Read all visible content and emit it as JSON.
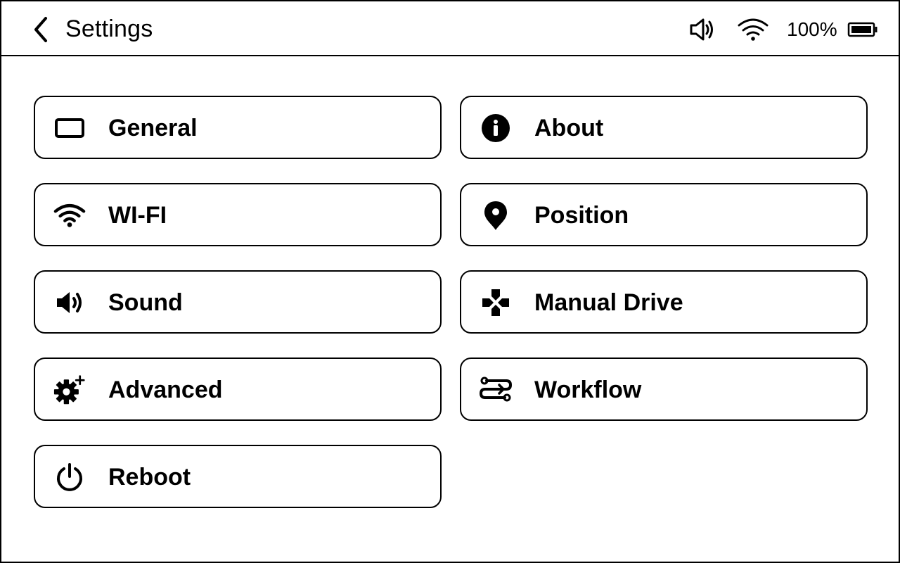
{
  "header": {
    "title": "Settings",
    "battery_text": "100%",
    "back_icon": "chevron-left-icon",
    "status_icons": [
      "volume-icon",
      "wifi-icon",
      "battery-icon"
    ]
  },
  "menu": {
    "general": {
      "label": "General",
      "icon": "display-icon"
    },
    "about": {
      "label": "About",
      "icon": "info-icon"
    },
    "wifi": {
      "label": "WI-FI",
      "icon": "wifi-icon"
    },
    "position": {
      "label": "Position",
      "icon": "map-pin-icon"
    },
    "sound": {
      "label": "Sound",
      "icon": "speaker-icon"
    },
    "manual_drive": {
      "label": "Manual Drive",
      "icon": "dpad-icon"
    },
    "advanced": {
      "label": "Advanced",
      "icon": "gear-plus-icon"
    },
    "workflow": {
      "label": "Workflow",
      "icon": "workflow-icon"
    },
    "reboot": {
      "label": "Reboot",
      "icon": "power-icon"
    }
  },
  "colors": {
    "foreground": "#000000",
    "background": "#ffffff"
  }
}
